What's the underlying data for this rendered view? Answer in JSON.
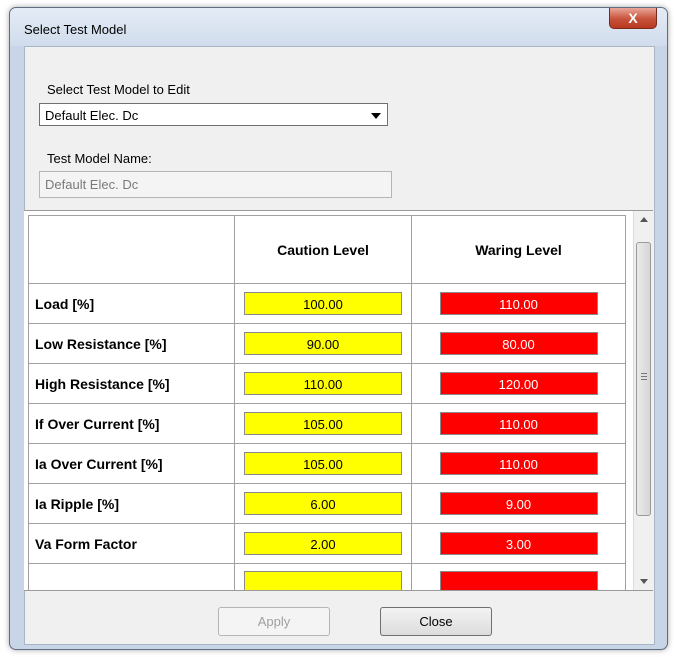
{
  "window": {
    "title": "Select Test Model",
    "close_icon": "X"
  },
  "form": {
    "select_label": "Select Test Model to Edit",
    "selected_model": "Default Elec. Dc",
    "name_label": "Test Model Name:",
    "name_value": "Default Elec. Dc"
  },
  "grid": {
    "columns": [
      "",
      "Caution Level",
      "Waring Level"
    ],
    "rows": [
      {
        "label": "Load [%]",
        "caution": "100.00",
        "warning": "110.00"
      },
      {
        "label": "Low Resistance [%]",
        "caution": "90.00",
        "warning": "80.00"
      },
      {
        "label": "High Resistance [%]",
        "caution": "110.00",
        "warning": "120.00"
      },
      {
        "label": "If Over Current [%]",
        "caution": "105.00",
        "warning": "110.00"
      },
      {
        "label": "Ia Over Current [%]",
        "caution": "105.00",
        "warning": "110.00"
      },
      {
        "label": "Ia Ripple [%]",
        "caution": "6.00",
        "warning": "9.00"
      },
      {
        "label": "Va Form Factor",
        "caution": "2.00",
        "warning": "3.00"
      },
      {
        "label": "",
        "caution": "",
        "warning": ""
      }
    ],
    "caution_color": "#ffff00",
    "warning_color": "#ff0000"
  },
  "buttons": {
    "apply": "Apply",
    "close": "Close"
  }
}
